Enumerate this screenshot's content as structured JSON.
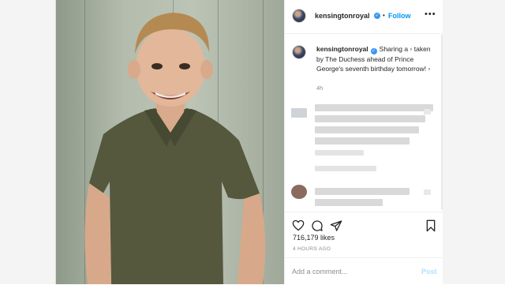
{
  "post": {
    "username": "kensingtonroyal",
    "follow_label": "Follow",
    "follow_separator": "•",
    "more_label": "•••",
    "caption_user": "kensingtonroyal",
    "caption_text": "Sharing a ▫ taken by The Duchess ahead of Prince George's seventh birthday tomorrow! ▫",
    "caption_time": "4h",
    "likes": "716,179 likes",
    "time_ago": "4 HOURS AGO",
    "comment_placeholder": "Add a comment...",
    "post_label": "Post"
  },
  "colors": {
    "accent": "#0095f6",
    "verified": "#3897f0",
    "muted": "#8e8e8e",
    "post_disabled": "#b2dffc"
  },
  "icons": {
    "like": "heart-icon",
    "comment": "speech-bubble-icon",
    "share": "paper-plane-icon",
    "save": "bookmark-icon",
    "more": "ellipsis-icon",
    "verified": "verified-badge-icon"
  }
}
